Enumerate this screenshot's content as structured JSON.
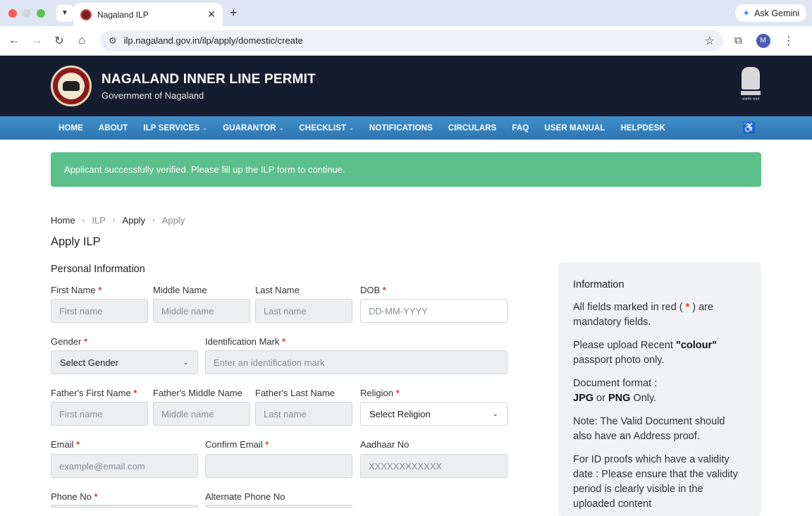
{
  "browser": {
    "tab_title": "Nagaland ILP",
    "tab_close": "✕",
    "new_tab": "+",
    "gemini_label": "Ask Gemini",
    "url": "ilp.nagaland.gov.in/ilp/apply/domestic/create",
    "avatar_letter": "M"
  },
  "site": {
    "title": "NAGALAND INNER LINE PERMIT",
    "subtitle": "Government of Nagaland",
    "emblem_motto": "सत्यमेव जयते"
  },
  "nav": {
    "items": [
      {
        "label": "HOME",
        "dropdown": false
      },
      {
        "label": "ABOUT",
        "dropdown": false
      },
      {
        "label": "ILP SERVICES",
        "dropdown": true
      },
      {
        "label": "GUARANTOR",
        "dropdown": true
      },
      {
        "label": "CHECKLIST",
        "dropdown": true
      },
      {
        "label": "NOTIFICATIONS",
        "dropdown": false
      },
      {
        "label": "CIRCULARS",
        "dropdown": false
      },
      {
        "label": "FAQ",
        "dropdown": false
      },
      {
        "label": "USER MANUAL",
        "dropdown": false
      },
      {
        "label": "HELPDESK",
        "dropdown": false
      }
    ]
  },
  "alert": {
    "text": "Applicant successfully verified. Please fill up the ILP form to continue."
  },
  "breadcrumb": {
    "home": "Home",
    "ilp": "ILP",
    "apply": "Apply",
    "current": "Apply"
  },
  "page": {
    "title": "Apply ILP",
    "section": "Personal Information"
  },
  "form": {
    "first_name": {
      "label": "First Name",
      "placeholder": "First name"
    },
    "middle_name": {
      "label": "Middle Name",
      "placeholder": "Middle name"
    },
    "last_name": {
      "label": "Last Name",
      "placeholder": "Last name"
    },
    "dob": {
      "label": "DOB",
      "placeholder": "DD-MM-YYYY"
    },
    "gender": {
      "label": "Gender",
      "value": "Select Gender"
    },
    "id_mark": {
      "label": "Identification Mark",
      "placeholder": "Enter an identification mark"
    },
    "father_first": {
      "label": "Father's First Name",
      "placeholder": "First name"
    },
    "father_middle": {
      "label": "Father's Middle Name",
      "placeholder": "Middle name"
    },
    "father_last": {
      "label": "Father's Last Name",
      "placeholder": "Last name"
    },
    "religion": {
      "label": "Religion",
      "value": "Select Religion"
    },
    "email": {
      "label": "Email",
      "placeholder": "example@email.com"
    },
    "confirm_email": {
      "label": "Confirm Email",
      "placeholder": ""
    },
    "aadhaar": {
      "label": "Aadhaar No",
      "placeholder": "XXXXXXXXXXXX"
    },
    "phone": {
      "label": "Phone No"
    },
    "alt_phone": {
      "label": "Alternate Phone No"
    },
    "required_mark": "*"
  },
  "info": {
    "title": "Information",
    "mandatory_pre": "All fields marked in red ( ",
    "mandatory_star": "*",
    "mandatory_post": " ) are mandatory fields.",
    "photo_pre": "Please upload Recent ",
    "photo_bold": "\"colour\"",
    "photo_post": " passport photo only.",
    "format_pre": "Document format :",
    "format_jpg": "JPG",
    "format_or": " or ",
    "format_png": "PNG",
    "format_post": " Only.",
    "note": "Note: The Valid Document should also have an Address proof.",
    "validity": "For ID proofs which have a validity date : Please ensure that the validity period is clearly visible in the uploaded content"
  }
}
